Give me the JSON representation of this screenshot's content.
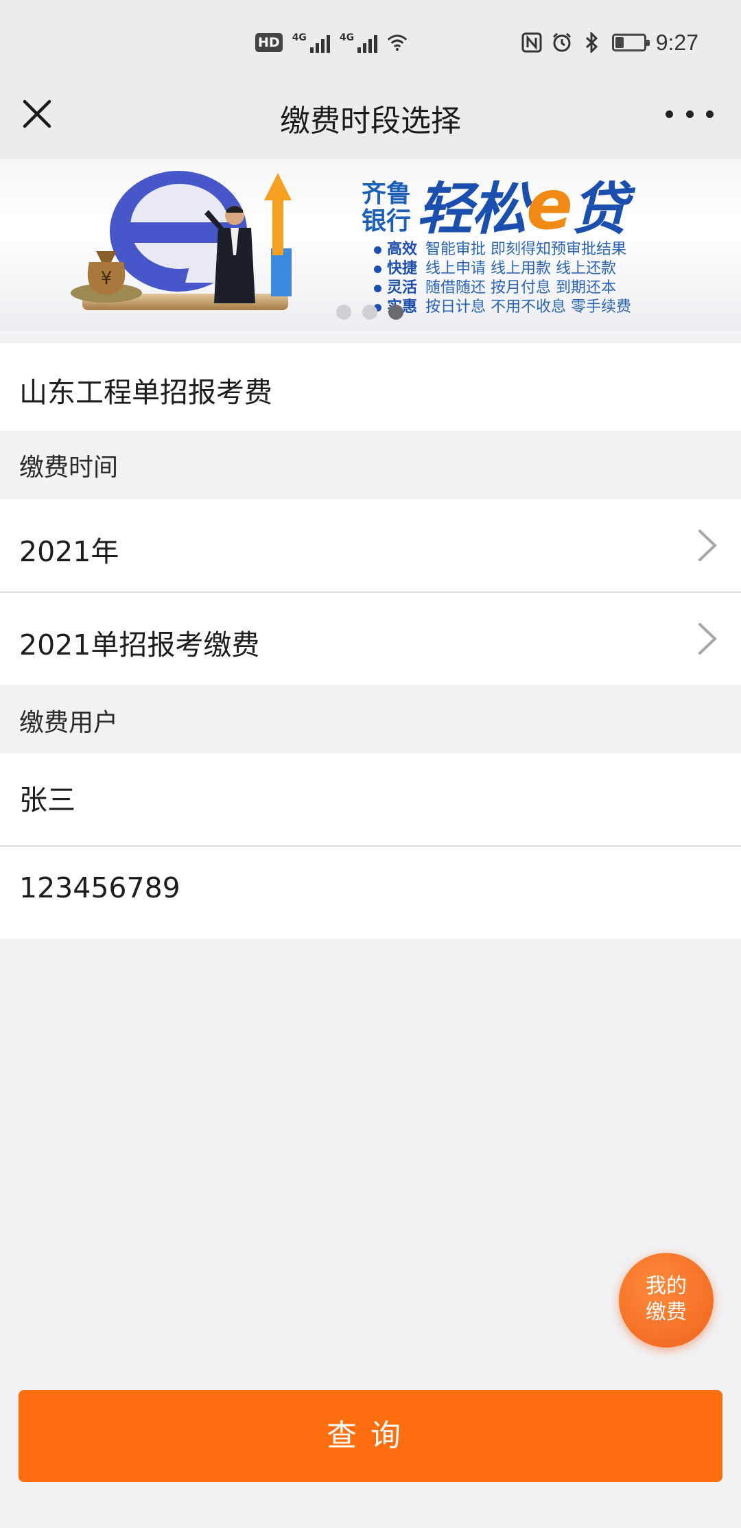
{
  "status_bar": {
    "hd_badge": "HD",
    "network1": "4G",
    "network2": "4G",
    "time": "9:27",
    "battery_percent": 30
  },
  "nav": {
    "title": "缴费时段选择"
  },
  "banner": {
    "bank_name": "齐鲁银行",
    "product_prefix": "轻松",
    "product_e": "e",
    "product_suffix": "贷",
    "features": [
      {
        "tag": "高效",
        "text": "智能审批  即刻得知预审批结果"
      },
      {
        "tag": "快捷",
        "text": "线上申请  线上用款  线上还款"
      },
      {
        "tag": "灵活",
        "text": "随借随还  按月付息  到期还本"
      },
      {
        "tag": "实惠",
        "text": "按日计息  不用不收息  零手续费"
      }
    ],
    "dots_total": 3,
    "dots_active": 3
  },
  "payment_item": {
    "name": "山东工程单招报考费"
  },
  "time_section": {
    "label": "缴费时间",
    "year": "2021年",
    "period": "2021单招报考缴费"
  },
  "user_section": {
    "label": "缴费用户",
    "name": "张三",
    "id": "123456789"
  },
  "fab": {
    "line1": "我的",
    "line2": "缴费"
  },
  "query_button": {
    "label": "查询"
  }
}
